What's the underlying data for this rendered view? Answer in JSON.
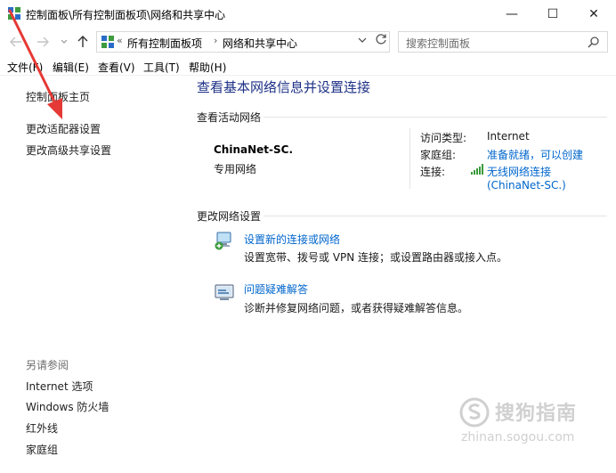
{
  "window": {
    "title": "控制面板\\所有控制面板项\\网络和共享中心",
    "controls": {
      "minimize": "—",
      "maximize": "☐",
      "close": "✕"
    }
  },
  "address": {
    "prefix": "«",
    "crumbs": [
      "所有控制面板项",
      "网络和共享中心"
    ],
    "separator": "›"
  },
  "search": {
    "placeholder": "搜索控制面板"
  },
  "menu": [
    "文件(F)",
    "编辑(E)",
    "查看(V)",
    "工具(T)",
    "帮助(H)"
  ],
  "sidebar": {
    "links": [
      "控制面板主页",
      "更改适配器设置",
      "更改高级共享设置"
    ],
    "see_also_title": "另请参阅",
    "see_also": [
      "Internet 选项",
      "Windows 防火墙",
      "红外线",
      "家庭组"
    ]
  },
  "main": {
    "title": "查看基本网络信息并设置连接",
    "active_networks_heading": "查看活动网络",
    "network": {
      "name": "ChinaNet-SC.",
      "category": "专用网络",
      "access_type_label": "访问类型:",
      "access_type_value": "Internet",
      "homegroup_label": "家庭组:",
      "homegroup_value": "准备就绪，可以创建",
      "connections_label": "连接:",
      "connection_line1": "无线网络连接",
      "connection_line2": "(ChinaNet-SC.)"
    },
    "change_settings_heading": "更改网络设置",
    "tasks": [
      {
        "link": "设置新的连接或网络",
        "desc": "设置宽带、拨号或 VPN 连接；或设置路由器或接入点。"
      },
      {
        "link": "问题疑难解答",
        "desc": "诊断并修复网络问题，或者获得疑难解答信息。"
      }
    ]
  },
  "watermark": {
    "brand": "搜狗指南",
    "url": "zhinan.sogou.com"
  },
  "colors": {
    "link": "#0066cc",
    "title": "#1e3287",
    "annotation": "#e53935"
  }
}
